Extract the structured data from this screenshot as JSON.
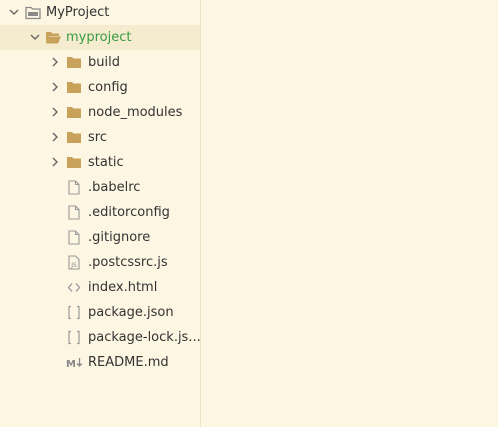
{
  "tree": {
    "root": {
      "label": "MyProject",
      "icon": "project-folder-icon",
      "expanded": true
    },
    "project": {
      "label": "myproject",
      "icon": "folder-open-icon",
      "expanded": true,
      "accent": "#3a9b42"
    },
    "folders": [
      {
        "label": "build",
        "icon": "folder-icon"
      },
      {
        "label": "config",
        "icon": "folder-icon"
      },
      {
        "label": "node_modules",
        "icon": "folder-icon"
      },
      {
        "label": "src",
        "icon": "folder-icon"
      },
      {
        "label": "static",
        "icon": "folder-icon"
      }
    ],
    "files": [
      {
        "label": ".babelrc",
        "icon": "file-icon"
      },
      {
        "label": ".editorconfig",
        "icon": "file-icon"
      },
      {
        "label": ".gitignore",
        "icon": "file-icon"
      },
      {
        "label": ".postcssrc.js",
        "icon": "js-file-icon"
      },
      {
        "label": "index.html",
        "icon": "html-file-icon"
      },
      {
        "label": "package.json",
        "icon": "json-file-icon"
      },
      {
        "label": "package-lock.js...",
        "icon": "json-file-icon"
      },
      {
        "label": "README.md",
        "icon": "markdown-file-icon"
      }
    ]
  },
  "colors": {
    "background": "#fdf6e3",
    "folder": "#c8a25a",
    "selected_row": "#f5ecd0",
    "accent": "#3a9b42"
  }
}
